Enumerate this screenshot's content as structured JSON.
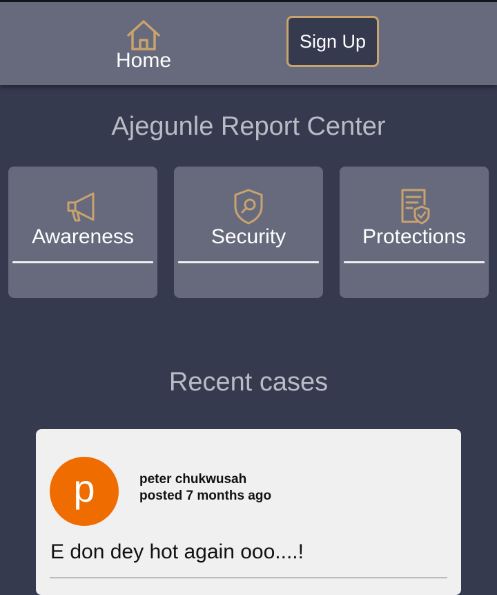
{
  "header": {
    "home_label": "Home",
    "home_icon": "home-icon",
    "signup_label": "Sign Up"
  },
  "page_title": "Ajegunle Report Center",
  "categories": [
    {
      "label": "Awareness",
      "icon": "megaphone-icon"
    },
    {
      "label": "Security",
      "icon": "shield-search-icon"
    },
    {
      "label": "Protections",
      "icon": "document-shield-icon"
    }
  ],
  "recent": {
    "title": "Recent cases",
    "cases": [
      {
        "avatar_letter": "p",
        "author": "peter chukwusah",
        "posted": "posted 7 months ago",
        "text": "E don dey hot again ooo....!"
      }
    ]
  },
  "colors": {
    "background": "#363a4f",
    "header": "#666a7c",
    "accent_gold": "#c9a36d",
    "avatar": "#ef6c00",
    "card": "#f0f0f0"
  }
}
